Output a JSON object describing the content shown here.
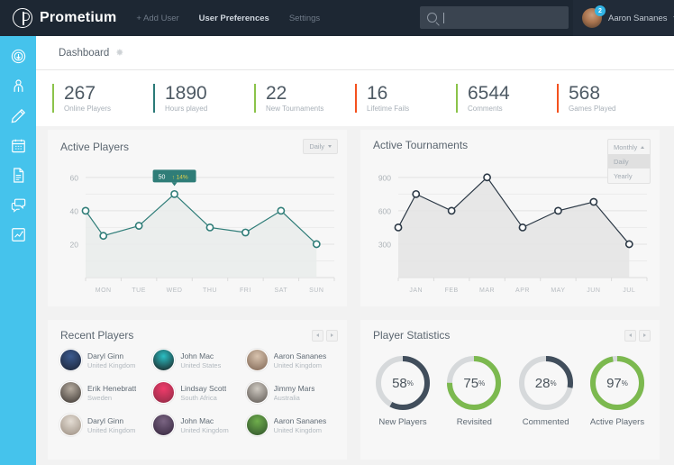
{
  "topnav": {
    "brand": "Prometium",
    "brand_icon": "prometium-logo-icon",
    "links": [
      {
        "label": "+ Add User",
        "active": false
      },
      {
        "label": "User Preferences",
        "active": true
      },
      {
        "label": "Settings",
        "active": false
      }
    ],
    "search": {
      "placeholder": "",
      "value": "",
      "icon": "search-icon"
    },
    "user": {
      "name": "Aaron Sananes",
      "notification_count": "2",
      "caret": "chevron-down-icon"
    }
  },
  "sidebar": {
    "items": [
      {
        "icon": "info-circle-icon",
        "name": "info"
      },
      {
        "icon": "user-icon",
        "name": "users"
      },
      {
        "icon": "pencil-icon",
        "name": "edit"
      },
      {
        "icon": "calendar-icon",
        "name": "calendar"
      },
      {
        "icon": "document-icon",
        "name": "documents"
      },
      {
        "icon": "chat-icon",
        "name": "messages"
      },
      {
        "icon": "chart-icon",
        "name": "analytics"
      }
    ]
  },
  "breadcrumb": {
    "title": "Dashboard",
    "gear_icon": "gear-icon"
  },
  "stats": [
    {
      "value": "267",
      "label": "Online Players",
      "color": "#8bc34a"
    },
    {
      "value": "1890",
      "label": "Hours played",
      "color": "#2b7a78"
    },
    {
      "value": "22",
      "label": "New Tournaments",
      "color": "#8bc34a"
    },
    {
      "value": "16",
      "label": "Lifetime Fails",
      "color": "#f4511e"
    },
    {
      "value": "6544",
      "label": "Comments",
      "color": "#8bc34a"
    },
    {
      "value": "568",
      "label": "Games Played",
      "color": "#f4511e"
    }
  ],
  "active_players_card": {
    "title": "Active Players",
    "dropdown": {
      "selected": "Daily",
      "caret": "chevron-down-icon"
    },
    "tooltip": {
      "value": "50",
      "delta": "14%",
      "arrow": "arrow-up-icon"
    }
  },
  "active_tournaments_card": {
    "title": "Active Tournaments",
    "dropdown": {
      "selected": "Monthly",
      "caret": "chevron-up-icon",
      "options": [
        {
          "label": "Monthly",
          "state": "selected"
        },
        {
          "label": "Daily",
          "state": "highlighted"
        },
        {
          "label": "Yearly",
          "state": "normal"
        }
      ]
    }
  },
  "recent_players_card": {
    "title": "Recent Players",
    "prev_icon": "chevron-left-icon",
    "next_icon": "chevron-right-icon",
    "players": [
      {
        "name": "Daryl Ginn",
        "country": "United Kingdom",
        "avatar_colors": [
          "#3b5a8f",
          "#1c2333"
        ]
      },
      {
        "name": "John Mac",
        "country": "United States",
        "avatar_colors": [
          "#2bbfc4",
          "#1a1a1a"
        ]
      },
      {
        "name": "Aaron Sananes",
        "country": "United Kingdom",
        "avatar_colors": [
          "#d8c3ae",
          "#7d6452"
        ]
      },
      {
        "name": "Erik Henebratt",
        "country": "Sweden",
        "avatar_colors": [
          "#b6aca0",
          "#3a3430"
        ]
      },
      {
        "name": "Lindsay Scott",
        "country": "South Africa",
        "avatar_colors": [
          "#ef3b6a",
          "#8c2b44"
        ]
      },
      {
        "name": "Jimmy Mars",
        "country": "Australia",
        "avatar_colors": [
          "#cfcac2",
          "#5b5550"
        ]
      },
      {
        "name": "Daryl Ginn",
        "country": "United Kingdom",
        "avatar_colors": [
          "#e4ddd4",
          "#9a8d80"
        ]
      },
      {
        "name": "John Mac",
        "country": "United Kingdom",
        "avatar_colors": [
          "#7a6482",
          "#33243c"
        ]
      },
      {
        "name": "Aaron Sananes",
        "country": "United Kingdom",
        "avatar_colors": [
          "#6fae4c",
          "#2e4f2a"
        ]
      }
    ]
  },
  "player_statistics_card": {
    "title": "Player Statistics",
    "prev_icon": "chevron-left-icon",
    "next_icon": "chevron-right-icon"
  },
  "chart_data": [
    {
      "type": "area",
      "name": "active-players-chart",
      "title": "Active Players",
      "categories": [
        "MON",
        "TUE",
        "WED",
        "THU",
        "FRI",
        "SAT",
        "SUN"
      ],
      "x": [
        0,
        0.5,
        1,
        1.5,
        2,
        3,
        4,
        5,
        6
      ],
      "values": [
        40,
        25,
        31,
        50,
        30,
        27,
        40,
        20
      ],
      "points": [
        {
          "x": 0,
          "label": "MON",
          "y": 40
        },
        {
          "x": 0.5,
          "label": "",
          "y": 25
        },
        {
          "x": 1.5,
          "label": "",
          "y": 31
        },
        {
          "x": 2.5,
          "label": "",
          "y": 50
        },
        {
          "x": 3.5,
          "label": "",
          "y": 30
        },
        {
          "x": 4.5,
          "label": "",
          "y": 27
        },
        {
          "x": 5.5,
          "label": "",
          "y": 40
        },
        {
          "x": 6.5,
          "label": "",
          "y": 20
        }
      ],
      "yticks": [
        20,
        40,
        60
      ],
      "ylim": [
        0,
        68
      ],
      "xlabel": "",
      "ylabel": "",
      "grid": true,
      "line_color": "#2f7d78",
      "fill_color": "#e9eceb",
      "legend": "none"
    },
    {
      "type": "area",
      "name": "active-tournaments-chart",
      "title": "Active Tournaments",
      "categories": [
        "JAN",
        "FEB",
        "MAR",
        "APR",
        "MAY",
        "JUN",
        "JUL"
      ],
      "values": [
        450,
        750,
        600,
        900,
        450,
        600,
        680,
        300
      ],
      "points": [
        {
          "x": 0,
          "label": "JAN",
          "y": 450
        },
        {
          "x": 0.5,
          "label": "",
          "y": 750
        },
        {
          "x": 1.5,
          "label": "",
          "y": 600
        },
        {
          "x": 2.5,
          "label": "",
          "y": 900
        },
        {
          "x": 3.5,
          "label": "",
          "y": 450
        },
        {
          "x": 4.5,
          "label": "",
          "y": 600
        },
        {
          "x": 5.5,
          "label": "",
          "y": 680
        },
        {
          "x": 6.5,
          "label": "",
          "y": 300
        }
      ],
      "yticks": [
        300,
        600,
        900
      ],
      "ylim": [
        0,
        1020
      ],
      "xlabel": "",
      "ylabel": "",
      "grid": true,
      "line_color": "#2b3845",
      "fill_color": "#e4e4e4",
      "legend": "none"
    },
    {
      "type": "pie",
      "name": "player-statistics-donuts",
      "title": "Player Statistics",
      "categories": [
        "New Players",
        "Revisited",
        "Commented",
        "Active Players"
      ],
      "values": [
        58,
        75,
        28,
        97
      ],
      "unit": "%",
      "colors": [
        "#414e5c",
        "#7cb94f",
        "#414e5c",
        "#7cb94f"
      ],
      "track_color": "#d6d9db"
    }
  ]
}
